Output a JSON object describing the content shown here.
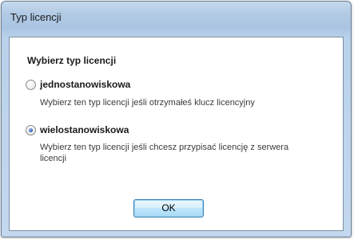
{
  "window": {
    "title": "Typ licencji"
  },
  "dialog": {
    "heading": "Wybierz typ licencji",
    "options": [
      {
        "label": "jednostanowiskowa",
        "description": "Wybierz ten typ licencji jeśli otrzymałeś klucz licencyjny",
        "selected": false
      },
      {
        "label": "wielostanowiskowa",
        "description": "Wybierz ten typ licencji jeśli chcesz przypisać licencję z serwera licencji",
        "selected": true
      }
    ],
    "ok_label": "OK"
  },
  "colors": {
    "titlebar": "#b3cbe5",
    "button_border": "#3c7fb1",
    "radio_selected": "#2f5fb6"
  }
}
